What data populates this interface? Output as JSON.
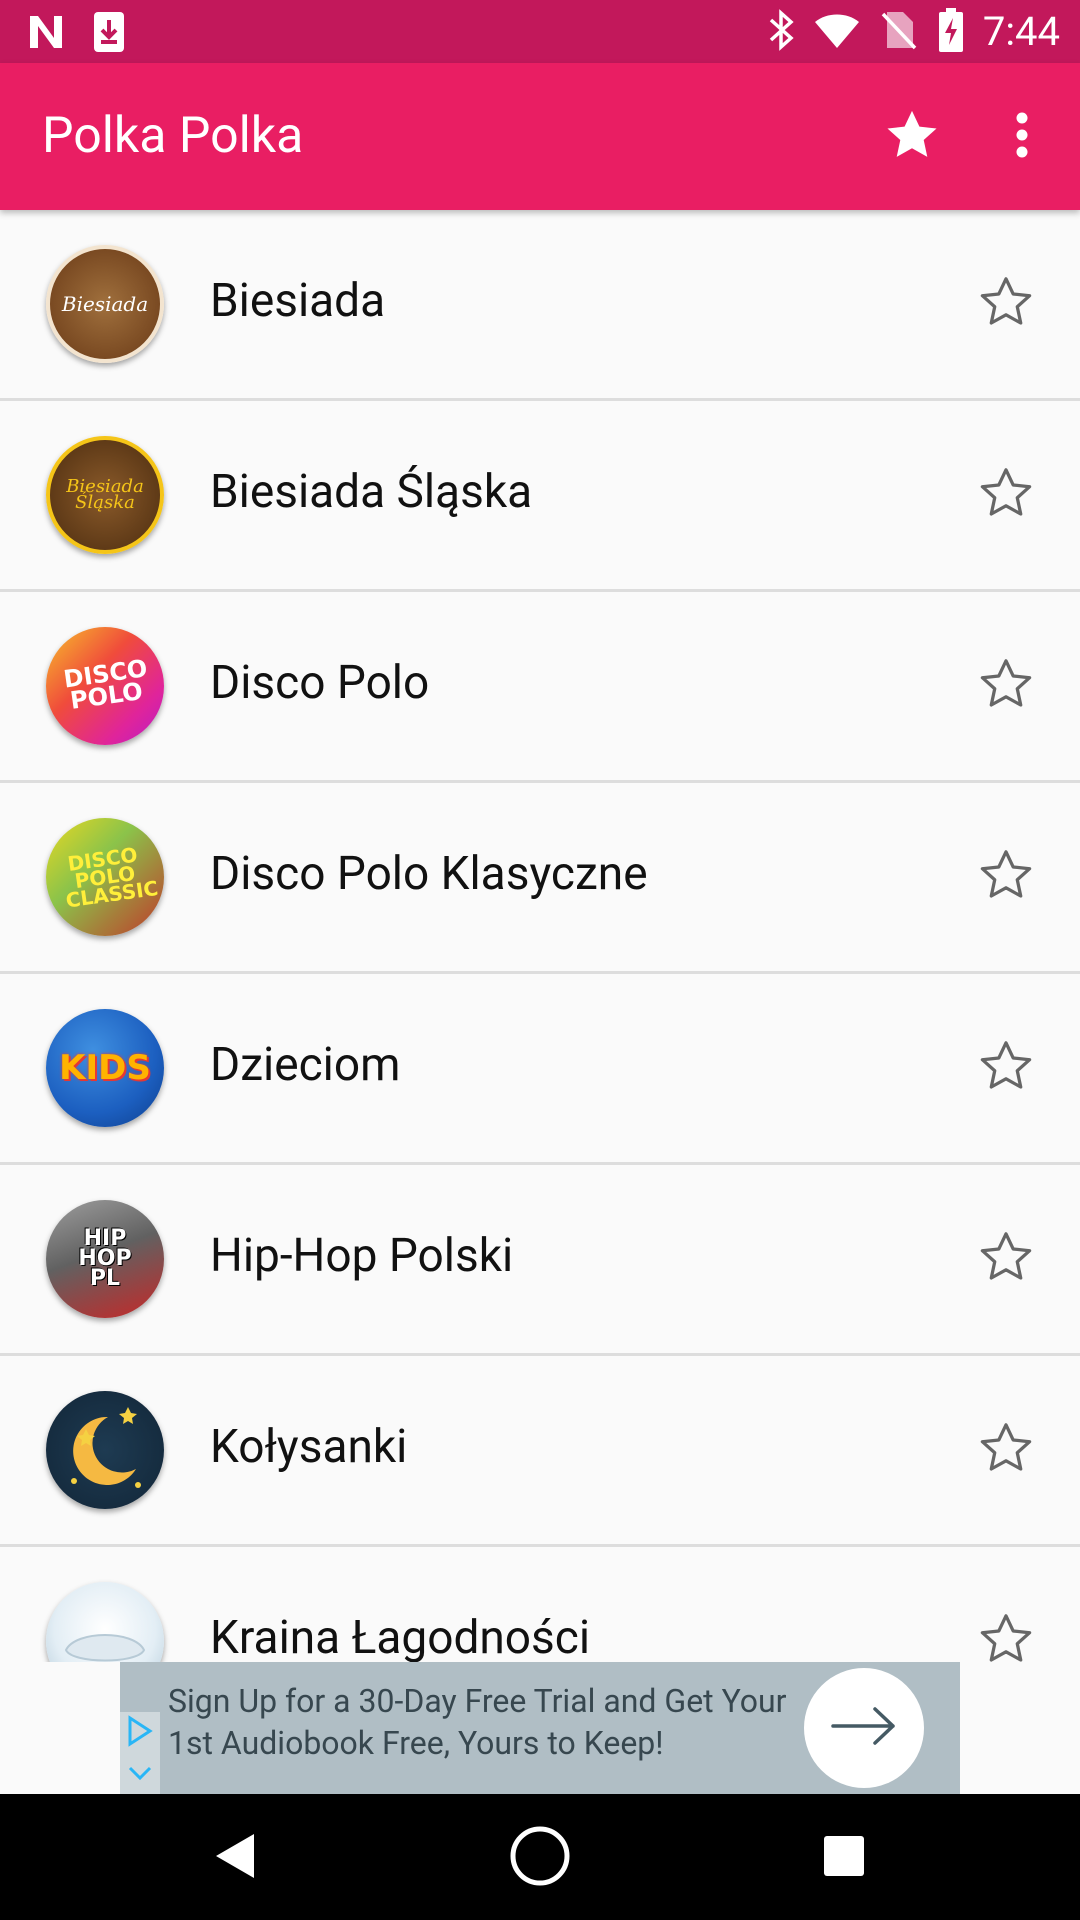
{
  "status_bar": {
    "time": "7:44",
    "icons": [
      "netflix-icon",
      "download-icon",
      "bluetooth-icon",
      "wifi-icon",
      "no-sim-icon",
      "battery-charging-icon"
    ]
  },
  "app_bar": {
    "title": "Polka Polka",
    "actions": [
      "favorites-star-icon",
      "overflow-menu-icon"
    ]
  },
  "stations": [
    {
      "name": "Biesiada",
      "logo_text": "Biesiada"
    },
    {
      "name": "Biesiada Śląska",
      "logo_text": "Biesiada Śląska"
    },
    {
      "name": "Disco Polo",
      "logo_text": "DISCO POLO"
    },
    {
      "name": "Disco Polo Klasyczne",
      "logo_text": "DISCO POLO CLASSIC"
    },
    {
      "name": "Dzieciom",
      "logo_text": "KIDS"
    },
    {
      "name": "Hip-Hop Polski",
      "logo_text": "HIP HOP PL"
    },
    {
      "name": "Kołysanki",
      "logo_text": ""
    },
    {
      "name": "Kraina Łagodności",
      "logo_text": ""
    }
  ],
  "ad": {
    "text": "Sign Up for a 30-Day Free Trial and Get Your 1st Audiobook Free, Yours to Keep!"
  },
  "colors": {
    "status_bar": "#c2185b",
    "app_bar": "#e91e63",
    "list_bg": "#fafafa",
    "divider": "#dddddd"
  }
}
